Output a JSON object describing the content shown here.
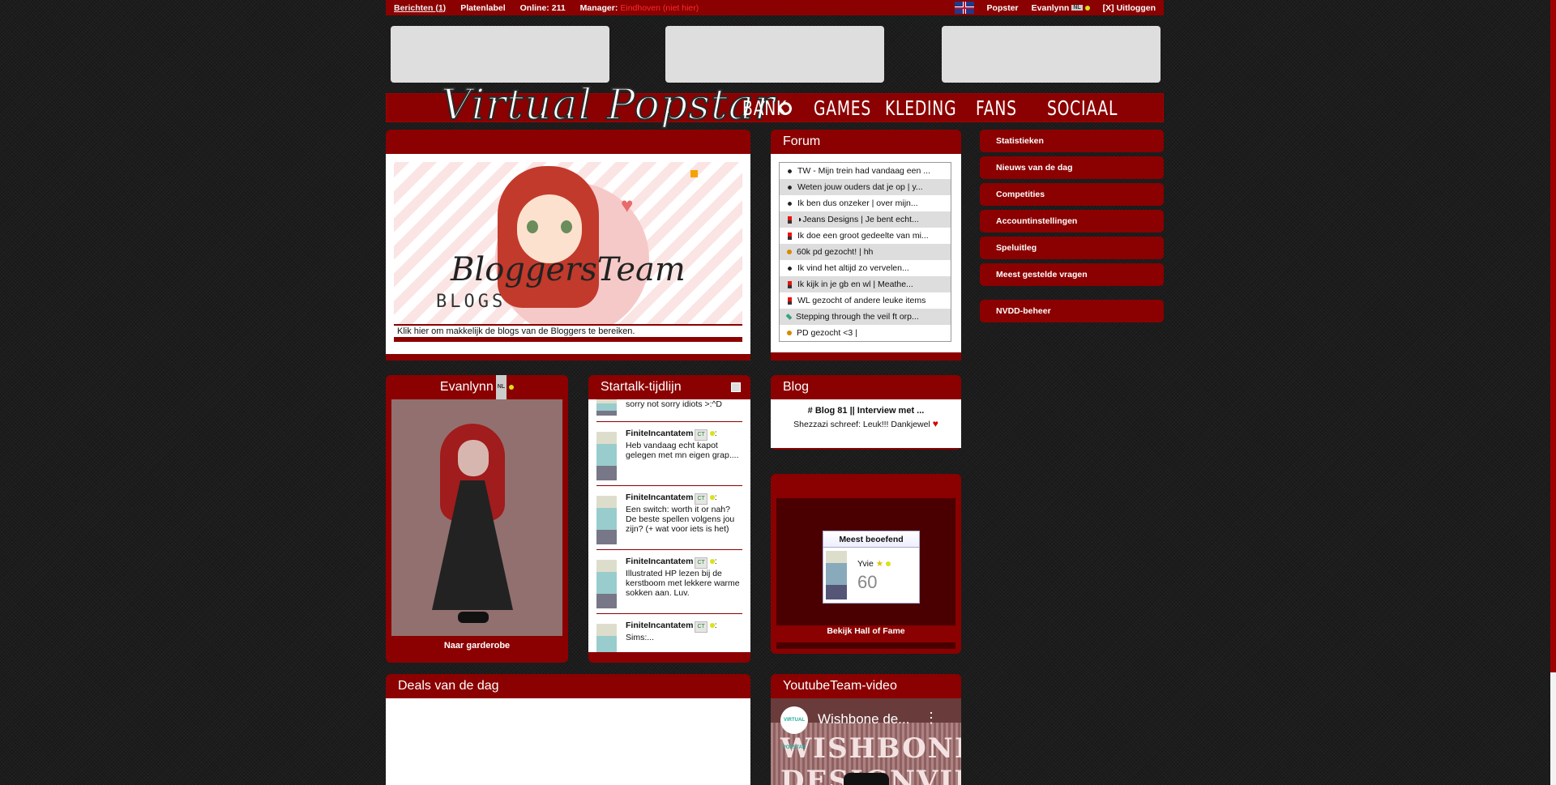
{
  "topbar": {
    "messages": "Berichten (1)",
    "label": "Platenlabel",
    "online": "Online: 211",
    "manager_label": "Manager:",
    "manager_value": "Eindhoven (niet hier)",
    "popstar": "Popster",
    "user": "Evanlynn",
    "logout": "[X] Uitloggen",
    "nl_badge": "NL"
  },
  "logo": {
    "text": "Virtual Popstar"
  },
  "nav": [
    "BANK",
    "GAMES",
    "KLEDING",
    "FANS",
    "SOCIAAL"
  ],
  "featured": {
    "banner_title": "BloggersTeam",
    "banner_sub": "BLOGS",
    "caption": "Klik hier om makkelijk de blogs van de Bloggers te bereiken."
  },
  "forum": {
    "title": "Forum",
    "topics": [
      {
        "icon": "eye-icon",
        "text": "TW - Mijn trein had vandaag een ..."
      },
      {
        "icon": "eye-icon",
        "text": "Weten jouw ouders dat je op | y..."
      },
      {
        "icon": "eye-icon",
        "text": "Ik ben dus onzeker | over mijn..."
      },
      {
        "icon": "lipstick-icon",
        "text": "◗Jeans Designs | Je bent echt..."
      },
      {
        "icon": "lipstick-icon",
        "text": "Ik doe een groot gedeelte van mi..."
      },
      {
        "icon": "coin-icon",
        "text": "60k pd gezocht! | hh"
      },
      {
        "icon": "eye-icon",
        "text": "Ik vind het altijd zo vervelen..."
      },
      {
        "icon": "lipstick-icon",
        "text": "Ik kijk in je gb en wl | Meathe..."
      },
      {
        "icon": "lipstick-icon",
        "text": "WL gezocht of andere leuke items"
      },
      {
        "icon": "pen-icon",
        "text": "Stepping through the veil ft orp..."
      },
      {
        "icon": "coin-icon",
        "text": "PD gezocht <3 |"
      }
    ]
  },
  "menu": {
    "items": [
      "Statistieken",
      "Nieuws van de dag",
      "Competities",
      "Accountinstellingen",
      "Speluitleg",
      "Meest gestelde vragen"
    ],
    "extra": "NVDD-beheer"
  },
  "profile": {
    "name": "Evanlynn",
    "wardrobe": "Naar garderobe"
  },
  "startalk": {
    "title": "Startalk-tijdlijn",
    "first_text": "sorry not sorry idiots >:^D",
    "posts": [
      {
        "user": "FiniteIncantatem",
        "text": "Heb vandaag echt kapot gelegen met mn eigen grap...."
      },
      {
        "user": "FiniteIncantatem",
        "text": "Een switch: worth it or nah? De beste spellen volgens jou zijn? (+ wat voor iets is het)"
      },
      {
        "user": "FiniteIncantatem",
        "text": "Illustrated HP lezen bij de kerstboom met lekkere warme sokken aan. Luv."
      },
      {
        "user": "FiniteIncantatem",
        "text": "Sims:..."
      }
    ],
    "badge": "CT"
  },
  "blog": {
    "title": "Blog",
    "entry_title": "# Blog 81 || Interview met ...",
    "entry_comment": "Shezzazi schreef: Leuk!!! Dankjewel"
  },
  "hof": {
    "card_title": "Meest beoefend",
    "user": "Yvie",
    "score": "60",
    "link": "Bekijk Hall of Fame"
  },
  "deals": {
    "title": "Deals van de dag"
  },
  "youtube": {
    "title": "YoutubeTeam-video",
    "video_title": "Wishbone de...",
    "video_overlay": "WISHBONE DESIGNVIDEO",
    "channel": "VIRTUAL POPSTAR"
  }
}
